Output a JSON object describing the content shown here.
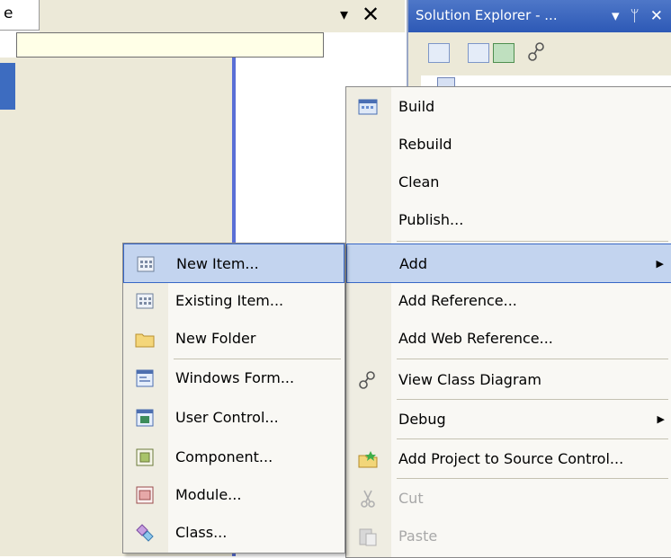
{
  "document_tab": {
    "label": "e"
  },
  "tool_window": {
    "title": "Solution Explorer - ...",
    "title_icons": [
      "▾",
      "ᛘ",
      "✕"
    ],
    "dock_controls": {
      "dropdown_glyph": "▾",
      "close_glyph": "✕"
    }
  },
  "project_menu": {
    "items": [
      {
        "label": "Build",
        "icon": "build-icon"
      },
      {
        "label": "Rebuild"
      },
      {
        "label": "Clean"
      },
      {
        "label": "Publish..."
      },
      {
        "label": "Add",
        "submenu": true,
        "highlighted": true
      },
      {
        "label": "Add Reference..."
      },
      {
        "label": "Add Web Reference..."
      },
      {
        "label": "View Class Diagram",
        "icon": "class-diagram-icon"
      },
      {
        "label": "Debug",
        "submenu": true
      },
      {
        "label": "Add Project to Source Control...",
        "icon": "source-control-icon"
      },
      {
        "label": "Cut",
        "icon": "cut-icon",
        "disabled": true
      },
      {
        "label": "Paste",
        "icon": "paste-icon",
        "disabled": true
      }
    ]
  },
  "add_submenu": {
    "items": [
      {
        "label": "New Item...",
        "icon": "new-item-icon",
        "highlighted": true
      },
      {
        "label": "Existing Item...",
        "icon": "existing-item-icon"
      },
      {
        "label": "New Folder",
        "icon": "folder-icon"
      },
      {
        "label": "Windows Form...",
        "icon": "windows-form-icon"
      },
      {
        "label": "User Control...",
        "icon": "user-control-icon"
      },
      {
        "label": "Component...",
        "icon": "component-icon"
      },
      {
        "label": "Module...",
        "icon": "module-icon"
      },
      {
        "label": "Class...",
        "icon": "class-icon"
      }
    ]
  },
  "colors": {
    "highlight_fill": "#c3d4ef",
    "highlight_border": "#3867c6",
    "menu_background": "#f9f8f4",
    "menu_gutter": "#efede2",
    "title_bar": "#3a65be"
  }
}
